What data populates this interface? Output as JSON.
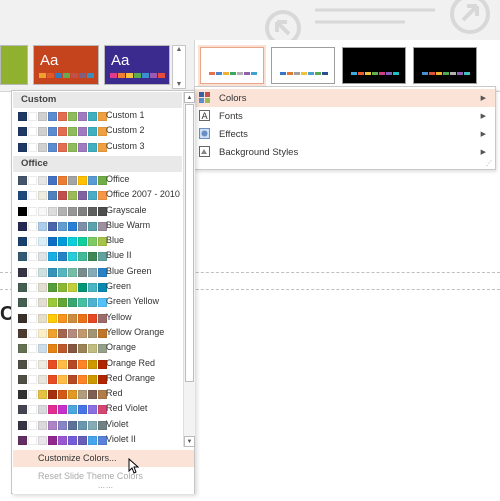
{
  "themes_gallery": {
    "themes": [
      {
        "label": "",
        "bg": "#8fb12f",
        "swatches": []
      },
      {
        "label": "Aa",
        "bg": "#c5431d",
        "swatches": [
          "#f0a030",
          "#e05a2a",
          "#2f7bbf",
          "#6aa84f",
          "#c0504d",
          "#7f6084",
          "#3b8fbf"
        ]
      },
      {
        "label": "Aa",
        "bg": "#3b2b8f",
        "swatches": [
          "#e03a8a",
          "#f08030",
          "#f5c040",
          "#5aaa50",
          "#3a8fd0",
          "#9b59b6",
          "#e74c3c"
        ]
      }
    ],
    "scroll_up": "▲",
    "scroll_down": "▼"
  },
  "variants": [
    {
      "bg": "#ffffff",
      "selected": true,
      "bar": [
        "#e8704a",
        "#4a86c8",
        "#f0b030",
        "#3aa860",
        "#b0b0b0",
        "#9060b0",
        "#40a0d0"
      ]
    },
    {
      "bg": "#ffffff",
      "selected": false,
      "bar": [
        "#3a76c0",
        "#e07a30",
        "#a0a0a0",
        "#f0c040",
        "#4aa0d0",
        "#5aa850",
        "#2a5090"
      ]
    },
    {
      "bg": "#000000",
      "selected": false,
      "bar": [
        "#40a8e0",
        "#f05a2a",
        "#f0c040",
        "#60b050",
        "#d04080",
        "#8060c0",
        "#20c0c0"
      ]
    },
    {
      "bg": "#000000",
      "selected": false,
      "bar": [
        "#4a90d0",
        "#e0503a",
        "#f0b030",
        "#50a850",
        "#b0b0b0",
        "#9060b0",
        "#40c0c0"
      ]
    }
  ],
  "submenu": {
    "items": [
      {
        "label": "Colors",
        "icon": "colors-icon",
        "arrow": "▶",
        "active": true
      },
      {
        "label": "Fonts",
        "icon": "fonts-icon",
        "arrow": "▶",
        "active": false
      },
      {
        "label": "Effects",
        "icon": "effects-icon",
        "arrow": "▶",
        "active": false
      },
      {
        "label": "Background Styles",
        "icon": "background-styles-icon",
        "arrow": "▶",
        "active": false
      }
    ],
    "grip": "⋰"
  },
  "slide": {
    "letter": "C"
  },
  "colors_menu": {
    "sections": [
      {
        "header": "Custom",
        "rows": [
          {
            "name": "Custom 1",
            "colors": [
              "#1f3864",
              "#ffffff",
              "#d0d0d0",
              "#5b8bd0",
              "#e46c50",
              "#8fbc5a",
              "#a07bc0",
              "#40b0c0",
              "#f0a040"
            ]
          },
          {
            "name": "Custom 2",
            "colors": [
              "#1f3864",
              "#ffffff",
              "#d0d0d0",
              "#5b8bd0",
              "#e46c50",
              "#8fbc5a",
              "#a07bc0",
              "#40b0c0",
              "#f0a040"
            ]
          },
          {
            "name": "Custom 3",
            "colors": [
              "#1f3864",
              "#ffffff",
              "#d0d0d0",
              "#5b8bd0",
              "#e46c50",
              "#8fbc5a",
              "#a07bc0",
              "#40b0c0",
              "#f0a040"
            ]
          }
        ]
      },
      {
        "header": "Office",
        "rows": [
          {
            "name": "Office",
            "colors": [
              "#44546a",
              "#ffffff",
              "#e7e6e6",
              "#4472c4",
              "#ed7d31",
              "#a5a5a5",
              "#ffc000",
              "#5b9bd5",
              "#70ad47"
            ]
          },
          {
            "name": "Office 2007 - 2010",
            "colors": [
              "#1f497d",
              "#ffffff",
              "#eeece1",
              "#4f81bd",
              "#c0504d",
              "#9bbb59",
              "#8064a2",
              "#4bacc6",
              "#f79646"
            ]
          },
          {
            "name": "Grayscale",
            "colors": [
              "#000000",
              "#ffffff",
              "#f8f8f8",
              "#dddddd",
              "#b2b2b2",
              "#969696",
              "#808080",
              "#5f5f5f",
              "#4d4d4d"
            ]
          },
          {
            "name": "Blue Warm",
            "colors": [
              "#242852",
              "#ffffff",
              "#acccea",
              "#4a66ac",
              "#629dd1",
              "#297fd5",
              "#7f8fa9",
              "#5aa2ae",
              "#9d90a0"
            ]
          },
          {
            "name": "Blue",
            "colors": [
              "#17406d",
              "#ffffff",
              "#dbeff9",
              "#0f6fc6",
              "#009dd9",
              "#0bd0d9",
              "#10cf9b",
              "#7cca62",
              "#a5c249"
            ]
          },
          {
            "name": "Blue II",
            "colors": [
              "#335b74",
              "#ffffff",
              "#dfe3e5",
              "#1cade4",
              "#2683c6",
              "#27ced7",
              "#42ba97",
              "#3e8853",
              "#62a39f"
            ]
          },
          {
            "name": "Blue Green",
            "colors": [
              "#373545",
              "#ffffff",
              "#cee0e0",
              "#3494ba",
              "#58b6c0",
              "#75bda7",
              "#7a8c8e",
              "#84acb6",
              "#2683c6"
            ]
          },
          {
            "name": "Green",
            "colors": [
              "#455f51",
              "#ffffff",
              "#e3ded1",
              "#549e39",
              "#8ab833",
              "#c0cf3a",
              "#029676",
              "#4ab5c4",
              "#0989b1"
            ]
          },
          {
            "name": "Green Yellow",
            "colors": [
              "#455f51",
              "#ffffff",
              "#e3ded1",
              "#99cb38",
              "#63a537",
              "#37a76f",
              "#44c1a3",
              "#4eb3cf",
              "#51c3f9"
            ]
          },
          {
            "name": "Yellow",
            "colors": [
              "#39302a",
              "#ffffff",
              "#e5dec9",
              "#ffca08",
              "#f8931d",
              "#ce8d3e",
              "#ec7016",
              "#e64823",
              "#9c6a6a"
            ]
          },
          {
            "name": "Yellow Orange",
            "colors": [
              "#4e3b30",
              "#ffffff",
              "#fbeec9",
              "#f0a22e",
              "#a5644e",
              "#b58b80",
              "#c3986d",
              "#a19574",
              "#c17529"
            ]
          },
          {
            "name": "Orange",
            "colors": [
              "#637052",
              "#ffffff",
              "#ccddea",
              "#e48312",
              "#bd582c",
              "#865640",
              "#9b8357",
              "#c2bc80",
              "#94a088"
            ]
          },
          {
            "name": "Orange Red",
            "colors": [
              "#505046",
              "#ffffff",
              "#eeece1",
              "#e84c22",
              "#ffbd47",
              "#b64926",
              "#ff8427",
              "#cc9900",
              "#b22600"
            ]
          },
          {
            "name": "Red Orange",
            "colors": [
              "#505046",
              "#ffffff",
              "#e9e5dc",
              "#e84c22",
              "#ffbd47",
              "#b64926",
              "#ff8427",
              "#cc9900",
              "#b22600"
            ]
          },
          {
            "name": "Red",
            "colors": [
              "#323232",
              "#ffffff",
              "#e5c243",
              "#a5300f",
              "#d55816",
              "#e19825",
              "#b19c7d",
              "#7f5f52",
              "#b27d49"
            ]
          },
          {
            "name": "Red Violet",
            "colors": [
              "#454551",
              "#ffffff",
              "#d8d9dc",
              "#e32d91",
              "#c830cc",
              "#4ea6dc",
              "#4775e7",
              "#8971e1",
              "#d54773"
            ]
          },
          {
            "name": "Violet",
            "colors": [
              "#373545",
              "#ffffff",
              "#dcd8dc",
              "#ad84c6",
              "#8784c7",
              "#5d739a",
              "#6997af",
              "#84acb6",
              "#6f8183"
            ]
          },
          {
            "name": "Violet II",
            "colors": [
              "#632e62",
              "#ffffff",
              "#eae5eb",
              "#92278f",
              "#9b57d3",
              "#755dd9",
              "#665eb8",
              "#45a5ed",
              "#5982db"
            ]
          }
        ]
      }
    ],
    "scroll_up": "▲",
    "scroll_down": "▼",
    "footer": {
      "customize_label": "Customize Colors...",
      "reset_label": "Reset Slide Theme Colors",
      "grip": "⋯⋯"
    }
  }
}
